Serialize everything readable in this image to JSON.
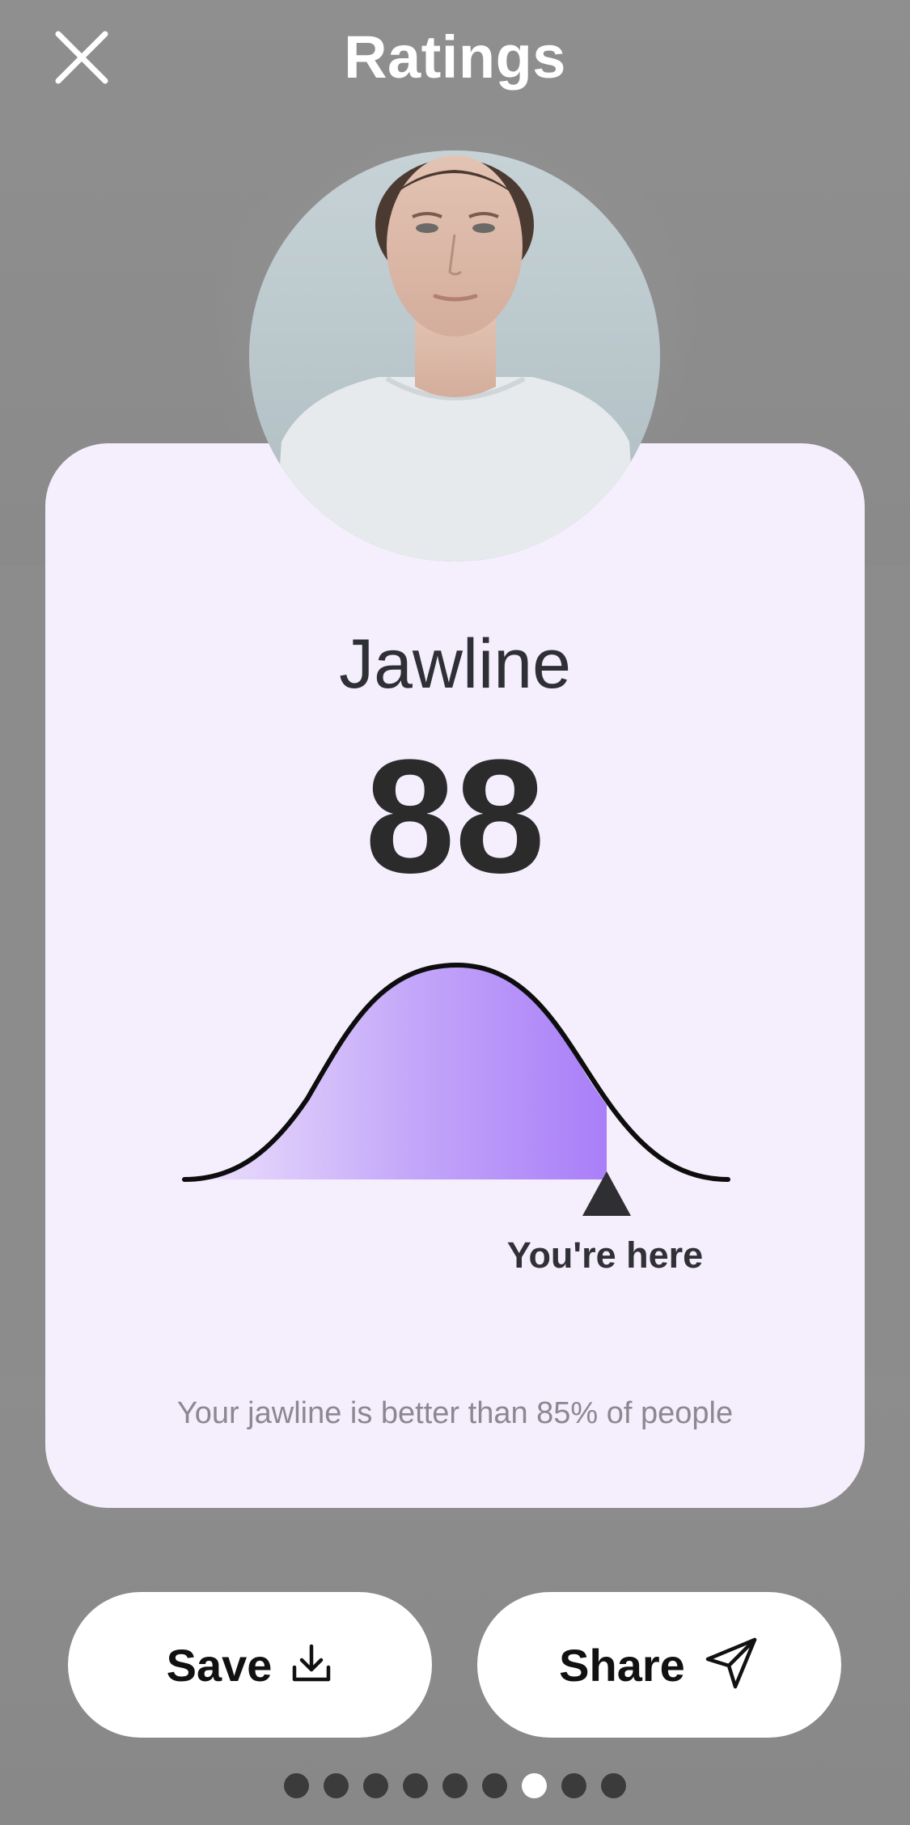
{
  "header": {
    "title": "Ratings",
    "close_icon": "close-icon"
  },
  "card": {
    "metric_name": "Jawline",
    "score": "88",
    "marker_label": "You're here",
    "caption": "Your jawline is better than 85% of people",
    "percentile": 85
  },
  "actions": {
    "save_label": "Save",
    "save_icon": "download-icon",
    "share_label": "Share",
    "share_icon": "send-icon"
  },
  "pagination": {
    "total": 9,
    "active_index": 6
  },
  "colors": {
    "card_background": "#f5effd",
    "curve_fill": "#a97ff8",
    "overlay": "#8c8c8c"
  }
}
